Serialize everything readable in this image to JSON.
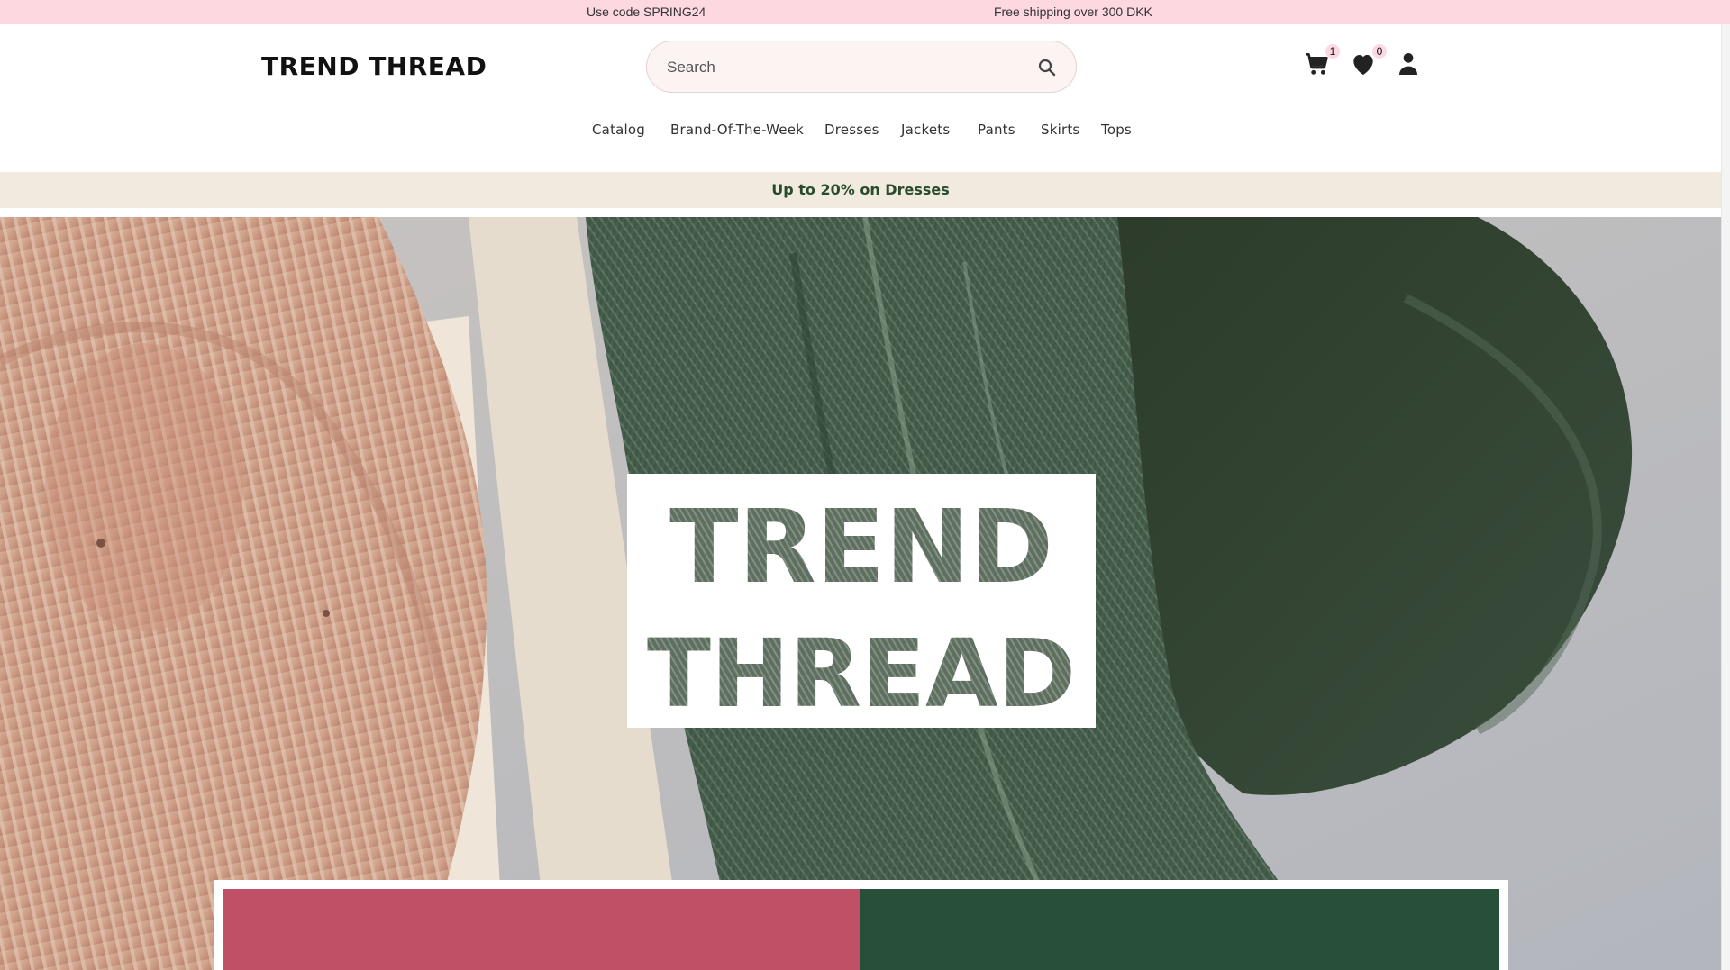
{
  "promo": {
    "messages": [
      "Use code SPRING24",
      "Free shipping over 300 DKK"
    ]
  },
  "header": {
    "logo": "TREND THREAD",
    "search_placeholder": "Search",
    "cart_count": "1",
    "wishlist_count": "0",
    "icons": [
      "search-icon",
      "cart-icon",
      "heart-icon",
      "user-icon"
    ]
  },
  "nav": {
    "items": [
      "Catalog",
      "Brand-Of-The-Week",
      "Dresses",
      "Jackets",
      "Pants",
      "Skirts",
      "Tops"
    ]
  },
  "sale_strip": {
    "text": "Up to 20% on Dresses"
  },
  "hero": {
    "title_line_1": "TREND",
    "title_line_2": "THREAD"
  },
  "colors": {
    "promo_bg": "#fdd8e0",
    "sale_bg": "#f1ebdf",
    "sale_text": "#2a4a2e",
    "panel_pink": "#c05066",
    "panel_green": "#284f37"
  }
}
